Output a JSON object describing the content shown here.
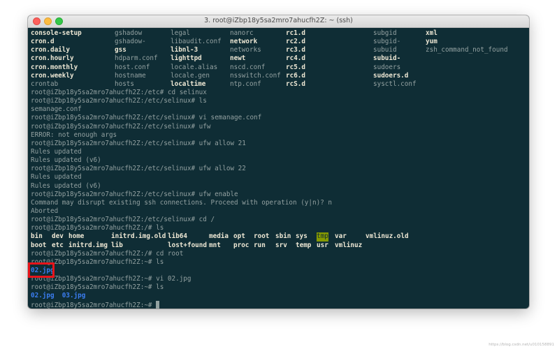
{
  "window": {
    "title": "3. root@iZbp18y5sa2mro7ahucfh2Z: ~ (ssh)"
  },
  "listing_etc": [
    [
      "console-setup",
      "gshadow",
      "legal",
      "nanorc",
      "rc1.d",
      "subgid",
      "xml"
    ],
    [
      "cron.d",
      "gshadow-",
      "libaudit.conf",
      "network",
      "rc2.d",
      "subgid-",
      "yum"
    ],
    [
      "cron.daily",
      "gss",
      "libnl-3",
      "networks",
      "rc3.d",
      "subuid",
      "zsh_command_not_found"
    ],
    [
      "cron.hourly",
      "hdparm.conf",
      "lighttpd",
      "newt",
      "rc4.d",
      "subuid-",
      ""
    ],
    [
      "cron.monthly",
      "host.conf",
      "locale.alias",
      "nscd.conf",
      "rc5.d",
      "sudoers",
      ""
    ],
    [
      "cron.weekly",
      "hostname",
      "locale.gen",
      "nsswitch.conf",
      "rc6.d",
      "sudoers.d",
      ""
    ],
    [
      "crontab",
      "hosts",
      "localtime",
      "ntp.conf",
      "rcS.d",
      "sysctl.conf",
      ""
    ]
  ],
  "lines": [
    "root@iZbp18y5sa2mro7ahucfh2Z:/etc# cd selinux",
    "root@iZbp18y5sa2mro7ahucfh2Z:/etc/selinux# ls",
    "semanage.conf",
    "root@iZbp18y5sa2mro7ahucfh2Z:/etc/selinux# vi semanage.conf",
    "root@iZbp18y5sa2mro7ahucfh2Z:/etc/selinux# ufw",
    "ERROR: not enough args",
    "root@iZbp18y5sa2mro7ahucfh2Z:/etc/selinux# ufw allow 21",
    "Rules updated",
    "Rules updated (v6)",
    "root@iZbp18y5sa2mro7ahucfh2Z:/etc/selinux# ufw allow 22",
    "Rules updated",
    "Rules updated (v6)",
    "root@iZbp18y5sa2mro7ahucfh2Z:/etc/selinux# ufw enable",
    "Command may disrupt existing ssh connections. Proceed with operation (y|n)? n",
    "Aborted",
    "root@iZbp18y5sa2mro7ahucfh2Z:/etc/selinux# cd /",
    "root@iZbp18y5sa2mro7ahucfh2Z:/# ls"
  ],
  "root_listing": [
    [
      "bin",
      "dev",
      "home",
      "initrd.img.old",
      "lib64",
      "media",
      "opt",
      "root",
      "sbin",
      "sys",
      "tmp",
      "var",
      "vmlinuz.old"
    ],
    [
      "boot",
      "etc",
      "initrd.img",
      "lib",
      "lost+found",
      "mnt",
      "proc",
      "run",
      "srv",
      "temp",
      "usr",
      "vmlinuz",
      ""
    ]
  ],
  "lines2": [
    "root@iZbp18y5sa2mro7ahucfh2Z:/# cd root",
    "root@iZbp18y5sa2mro7ahucfh2Z:~# ls"
  ],
  "ls_result_1": "02.jpg",
  "lines3": [
    "root@iZbp18y5sa2mro7ahucfh2Z:~# vi 02.jpg",
    "root@iZbp18y5sa2mro7ahucfh2Z:~# ls"
  ],
  "ls_result_2": [
    "02.jpg",
    "03.jpg"
  ],
  "last_prompt": "root@iZbp18y5sa2mro7ahucfh2Z:~# ",
  "watermark": "https://blog.csdn.net/u010158891"
}
